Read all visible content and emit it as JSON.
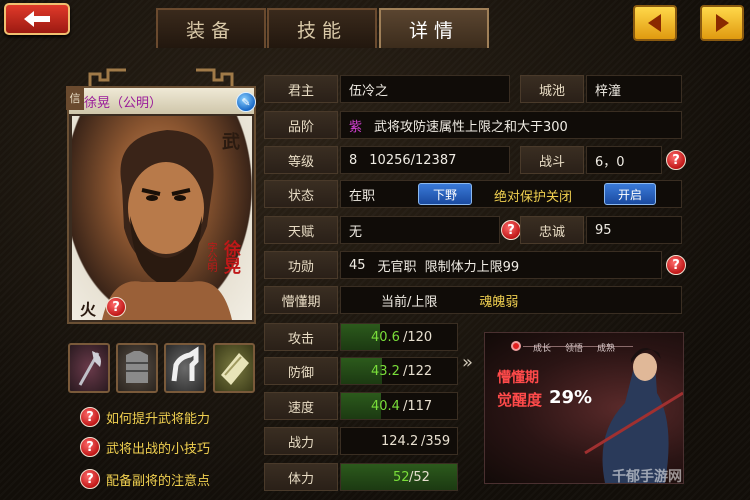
{
  "tabs": [
    {
      "label": "装备"
    },
    {
      "label": "技能"
    },
    {
      "label": "详情"
    }
  ],
  "general": {
    "name": "徐晃（公明）",
    "type_char": "武",
    "element": "火",
    "seal_name": "徐晃",
    "seal_zi": "字公明"
  },
  "help_links": [
    "如何提升武将能力",
    "武将出战的小技巧",
    "配备副将的注意点"
  ],
  "info": {
    "lord_label": "君主",
    "lord_value": "伍冷之",
    "city_label": "城池",
    "city_value": "梓潼",
    "rank_label": "品阶",
    "rank_color": "紫",
    "rank_desc": "武将攻防速属性上限之和大于300",
    "level_label": "等级",
    "level_value": "8",
    "exp_value": "10256/12387",
    "battle_label": "战斗",
    "battle_value": "6，0",
    "status_label": "状态",
    "status_value": "在职",
    "dismiss_button": "下野",
    "protect_label": "绝对保护关闭",
    "open_button": "开启",
    "talent_label": "天赋",
    "talent_value": "无",
    "loyalty_label": "忠诚",
    "loyalty_value": "95",
    "merit_label": "功勋",
    "merit_value": "45",
    "merit_title": "无官职",
    "merit_desc": "限制体力上限99",
    "awaken_label": "懵懂期",
    "awaken_current": "当前/上限",
    "awaken_soul": "魂魄弱"
  },
  "stats": [
    {
      "label": "攻击",
      "current": "40.6",
      "max": "/120",
      "fraction": 0.338,
      "highlight": "green"
    },
    {
      "label": "防御",
      "current": "43.2",
      "max": "/122",
      "fraction": 0.354,
      "highlight": "green"
    },
    {
      "label": "速度",
      "current": "40.4",
      "max": "/117",
      "fraction": 0.345,
      "highlight": "green"
    },
    {
      "label": "战力",
      "current": "124.2",
      "max": "/359",
      "fraction": 0.346,
      "highlight": "plain"
    },
    {
      "label": "体力",
      "current": "52",
      "max": "/52",
      "fraction": 1.0,
      "highlight": "green"
    }
  ],
  "awaken_panel": {
    "stage_labels": [
      "成长",
      "领悟",
      "成熟"
    ],
    "stage_title": "懵懂期",
    "progress_label": "觉醒度",
    "progress_value": "29%",
    "progress_fraction": 0.29
  },
  "watermark": "千郁手游网",
  "colors": {
    "accent_gold": "#f0d050",
    "stat_green": "#7ade3a",
    "rank_purple": "#d040d0",
    "help_red": "#c01818",
    "button_blue": "#1a4aa0"
  }
}
